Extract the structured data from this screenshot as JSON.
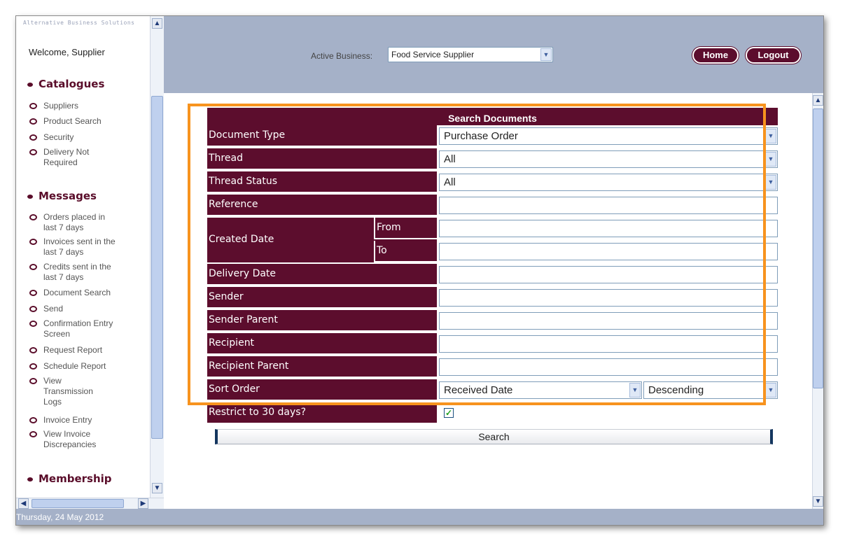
{
  "sidebar": {
    "logo_text": "Alternative Business Solutions",
    "welcome": "Welcome, Supplier",
    "sections": [
      {
        "title": "Catalogues",
        "items": [
          "Suppliers",
          "Product Search",
          "Security",
          "Delivery Not Required"
        ]
      },
      {
        "title": "Messages",
        "items": [
          "Orders placed in last 7 days",
          "Invoices sent in the last 7 days",
          "Credits sent in the last 7 days",
          "Document Search",
          "Send",
          "Confirmation Entry Screen",
          "Request Report",
          "Schedule Report",
          "View Transmission Logs",
          "Invoice Entry",
          "View Invoice Discrepancies"
        ]
      },
      {
        "title": "Membership",
        "items": []
      }
    ],
    "status_date": "Thursday, 24 May 2012"
  },
  "header": {
    "active_business_label": "Active Business:",
    "active_business_value": "Food Service Supplier",
    "home_label": "Home",
    "logout_label": "Logout"
  },
  "form": {
    "title": "Search Documents",
    "document_type": {
      "label": "Document Type",
      "value": "Purchase Order"
    },
    "thread": {
      "label": "Thread",
      "value": "All"
    },
    "thread_status": {
      "label": "Thread Status",
      "value": "All"
    },
    "reference": {
      "label": "Reference",
      "value": ""
    },
    "created_date": {
      "label": "Created Date",
      "from_label": "From",
      "to_label": "To",
      "from_value": "",
      "to_value": ""
    },
    "delivery_date": {
      "label": "Delivery Date",
      "value": ""
    },
    "sender": {
      "label": "Sender",
      "value": ""
    },
    "sender_parent": {
      "label": "Sender Parent",
      "value": ""
    },
    "recipient": {
      "label": "Recipient",
      "value": ""
    },
    "recipient_parent": {
      "label": "Recipient Parent",
      "value": ""
    },
    "sort_order": {
      "label": "Sort Order",
      "field": "Received Date",
      "direction": "Descending"
    },
    "restrict": {
      "label": "Restrict to 30 days?",
      "checked": true
    },
    "search_label": "Search"
  },
  "colors": {
    "brand": "#5c0d2d",
    "header_bg": "#a5b1c8",
    "highlight": "#f7931e"
  }
}
